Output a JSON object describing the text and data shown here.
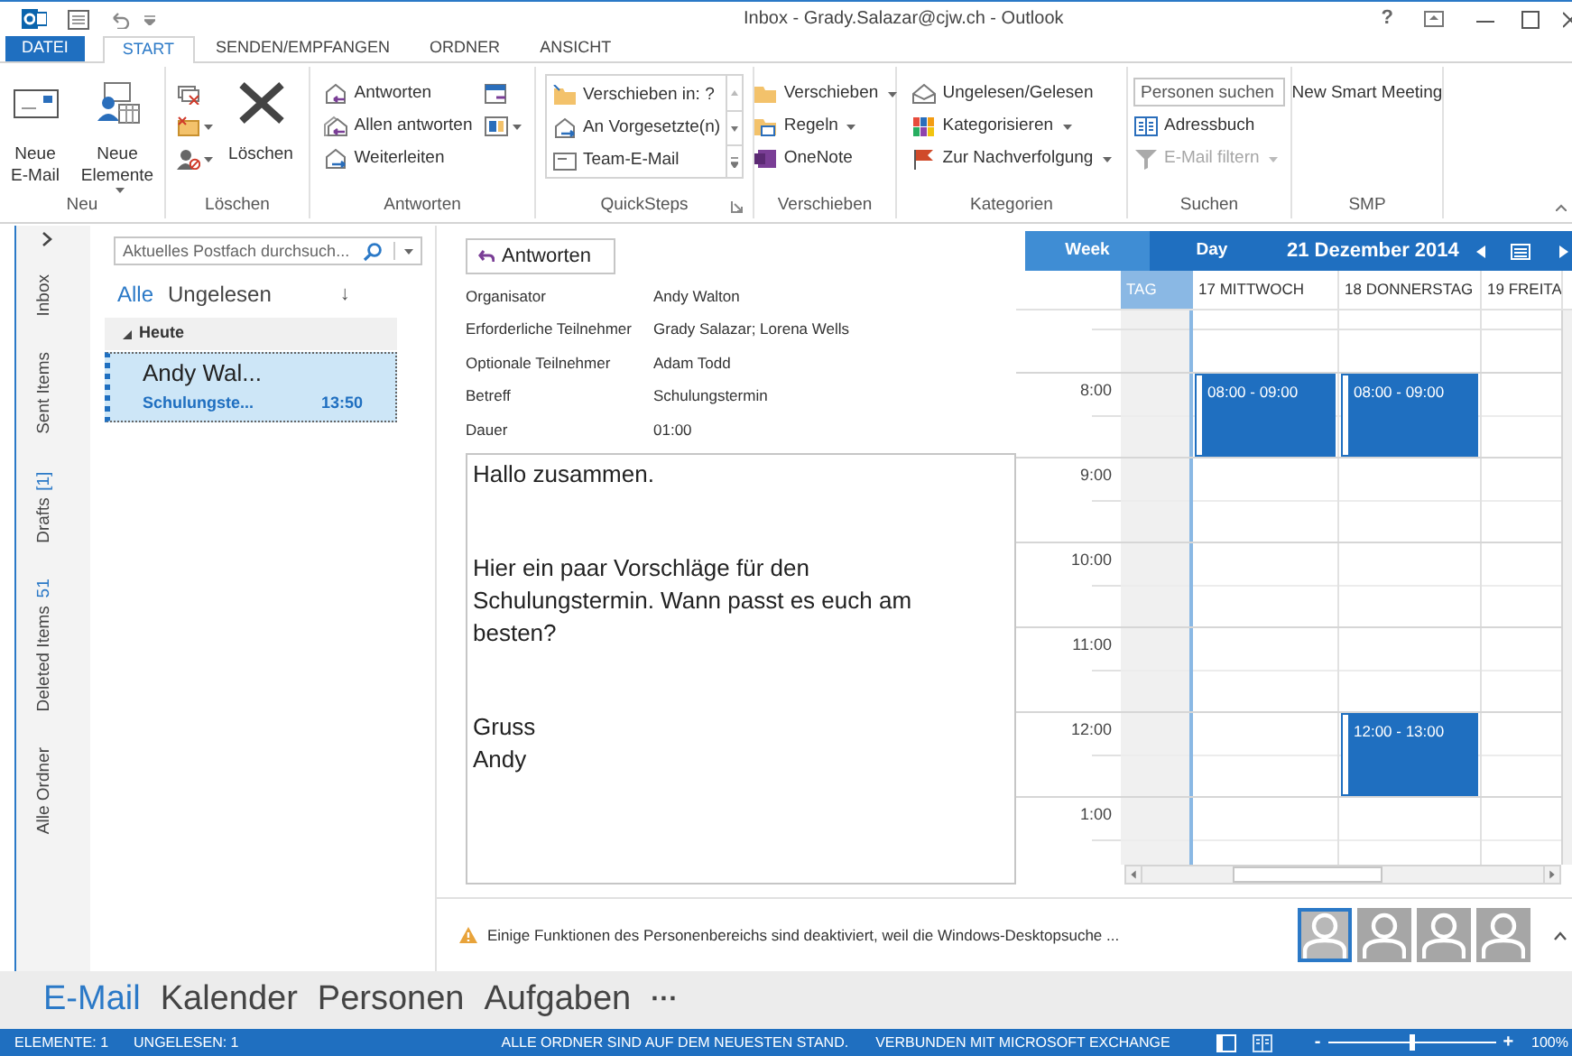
{
  "window": {
    "title": "Inbox - Grady.Salazar@cjw.ch - Outlook",
    "help": "?"
  },
  "ribbon_tabs": [
    {
      "label": "DATEI",
      "kind": "file",
      "selected": false
    },
    {
      "label": "START",
      "kind": "tab",
      "selected": true
    },
    {
      "label": "SENDEN/EMPFANGEN",
      "kind": "tab",
      "selected": false
    },
    {
      "label": "ORDNER",
      "kind": "tab",
      "selected": false
    },
    {
      "label": "ANSICHT",
      "kind": "tab",
      "selected": false
    }
  ],
  "ribbon_groups": [
    {
      "label": "Neu",
      "kind": "plain",
      "dialog_launcher": false,
      "columns": [
        [
          {
            "kind": "large",
            "label": "Neue E-Mail",
            "dropdown": false,
            "disabled": false
          }
        ],
        [
          {
            "kind": "large",
            "label": "Neue Elemente",
            "dropdown": true,
            "disabled": false
          }
        ]
      ]
    },
    {
      "label": "Löschen",
      "kind": "plain",
      "dialog_launcher": false,
      "columns": [
        [
          {
            "kind": "icon",
            "dropdown": false,
            "disabled": false
          },
          {
            "kind": "icon",
            "dropdown": true,
            "disabled": false
          },
          {
            "kind": "icon",
            "dropdown": true,
            "disabled": false
          }
        ],
        [
          {
            "kind": "large",
            "label": "Löschen",
            "dropdown": false,
            "disabled": false
          }
        ]
      ]
    },
    {
      "label": "Antworten",
      "kind": "plain",
      "dialog_launcher": false,
      "columns": [
        [
          {
            "kind": "small",
            "label": "Antworten",
            "dropdown": false,
            "disabled": false
          },
          {
            "kind": "small",
            "label": "Allen antworten",
            "dropdown": false,
            "disabled": false
          },
          {
            "kind": "small",
            "label": "Weiterleiten",
            "dropdown": false,
            "disabled": false
          }
        ],
        [
          {
            "kind": "icon",
            "dropdown": false,
            "disabled": false
          },
          {
            "kind": "icon",
            "dropdown": true,
            "disabled": false
          }
        ]
      ]
    },
    {
      "label": "QuickSteps",
      "kind": "gallery",
      "dialog_launcher": true,
      "columns": [
        [
          {
            "kind": "small",
            "label": "Verschieben in: ?",
            "dropdown": false,
            "disabled": false
          },
          {
            "kind": "small",
            "label": "An Vorgesetzte(n)",
            "dropdown": false,
            "disabled": false
          },
          {
            "kind": "small",
            "label": "Team-E-Mail",
            "dropdown": false,
            "disabled": false
          }
        ]
      ]
    },
    {
      "label": "Verschieben",
      "kind": "plain",
      "dialog_launcher": false,
      "columns": [
        [
          {
            "kind": "small",
            "label": "Verschieben",
            "dropdown": true,
            "disabled": false
          },
          {
            "kind": "small",
            "label": "Regeln",
            "dropdown": true,
            "disabled": false
          },
          {
            "kind": "small",
            "label": "OneNote",
            "dropdown": false,
            "disabled": false
          }
        ]
      ]
    },
    {
      "label": "Kategorien",
      "kind": "plain",
      "dialog_launcher": false,
      "columns": [
        [
          {
            "kind": "small",
            "label": "Ungelesen/Gelesen",
            "dropdown": false,
            "disabled": false
          },
          {
            "kind": "small",
            "label": "Kategorisieren",
            "dropdown": true,
            "disabled": false
          },
          {
            "kind": "small",
            "label": "Zur Nachverfolgung",
            "dropdown": true,
            "disabled": false
          }
        ]
      ]
    },
    {
      "label": "Suchen",
      "kind": "plain",
      "dialog_launcher": false,
      "columns": [
        [
          {
            "kind": "field",
            "placeholder": "Personen suchen",
            "disabled": false
          },
          {
            "kind": "small",
            "label": "Adressbuch",
            "dropdown": false,
            "disabled": false
          },
          {
            "kind": "small",
            "label": "E-Mail filtern",
            "dropdown": true,
            "disabled": true
          }
        ]
      ]
    },
    {
      "label": "SMP",
      "kind": "plain",
      "dialog_launcher": false,
      "columns": [
        [
          {
            "kind": "text",
            "label": "New Smart Meeting",
            "disabled": false
          }
        ]
      ]
    }
  ],
  "folder_strip": {
    "folders": [
      {
        "name": "Inbox"
      },
      {
        "name": "Sent Items"
      },
      {
        "name": "Drafts",
        "count": "[1]"
      },
      {
        "name": "Deleted Items",
        "count": "51"
      },
      {
        "name": "Alle Ordner"
      }
    ]
  },
  "message_list": {
    "search": {
      "placeholder": "Aktuelles Postfach durchsuch..."
    },
    "filters": [
      {
        "label": "Alle",
        "selected": true
      },
      {
        "label": "Ungelesen",
        "selected": false
      }
    ],
    "sort": "↓",
    "groups": [
      {
        "label": "Heute",
        "expanded": true,
        "messages": [
          {
            "sender": "Andy Wal...",
            "subject": "Schulungste...",
            "time": "13:50",
            "selected": true
          }
        ]
      }
    ]
  },
  "reading_pane": {
    "reply_button": "Antworten",
    "fields": [
      {
        "label": "Organisator",
        "value": "Andy Walton"
      },
      {
        "label": "Erforderliche Teilnehmer",
        "value": "Grady Salazar; Lorena Wells"
      },
      {
        "label": "Optionale Teilnehmer",
        "value": "Adam Todd"
      },
      {
        "label": "Betreff",
        "value": "Schulungstermin"
      },
      {
        "label": "Dauer",
        "value": "01:00"
      }
    ],
    "body": [
      [
        "Hallo zusammen."
      ],
      [
        "Hier ein paar Vorschläge für den Schulungstermin. Wann passt es euch am besten?"
      ],
      [
        "Gruss",
        "Andy"
      ]
    ]
  },
  "calendar": {
    "views": [
      {
        "label": "Week",
        "selected": true
      },
      {
        "label": "Day",
        "selected": false
      }
    ],
    "title": "21 Dezember 2014",
    "days": [
      {
        "label": "TAG",
        "selected": true
      },
      {
        "label": "17 MITTWOCH",
        "selected": false
      },
      {
        "label": "18 DONNERSTAG",
        "selected": false
      },
      {
        "label": "19 FREITA",
        "selected": false
      }
    ],
    "hours": [
      {
        "label": "8:00",
        "cells": [
          {
            "busy": false
          },
          {
            "busy": true,
            "event": "08:00 - 09:00"
          },
          {
            "busy": true,
            "event": "08:00 - 09:00"
          },
          {
            "busy": false
          }
        ]
      },
      {
        "label": "9:00"
      },
      {
        "label": "10:00"
      },
      {
        "label": "11:00"
      },
      {
        "label": "12:00",
        "cells": [
          {
            "busy": false
          },
          {
            "busy": false
          },
          {
            "busy": true,
            "event": "12:00 - 13:00"
          },
          {
            "busy": false
          }
        ]
      },
      {
        "label": "1:00"
      }
    ]
  },
  "people_pane": {
    "message": "Einige Funktionen des Personenbereichs sind deaktiviert, weil die Windows-Desktopsuche ...",
    "people": [
      {
        "selected": true
      },
      {
        "selected": false
      },
      {
        "selected": false
      },
      {
        "selected": false
      }
    ]
  },
  "navigation": {
    "items": [
      {
        "label": "E-Mail",
        "selected": true
      },
      {
        "label": "Kalender",
        "selected": false
      },
      {
        "label": "Personen",
        "selected": false
      },
      {
        "label": "Aufgaben",
        "selected": false
      }
    ],
    "more": "···"
  },
  "status_bar": {
    "left": [
      "ELEMENTE: 1",
      "UNGELESEN: 1"
    ],
    "right": [
      "ALLE ORDNER SIND AUF DEM NEUESTEN STAND.",
      "VERBUNDEN MIT MICROSOFT EXCHANGE"
    ],
    "zoom": {
      "out": "-",
      "level": 0.5,
      "in": "+",
      "reading": "100%"
    }
  }
}
